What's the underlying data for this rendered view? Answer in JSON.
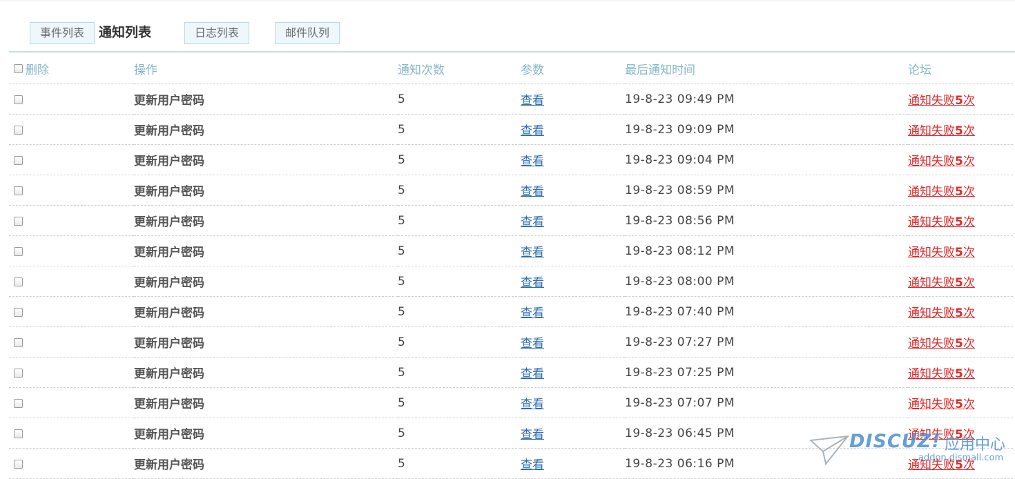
{
  "tabs": [
    {
      "label": "事件列表",
      "active": false
    },
    {
      "label": "通知列表",
      "active": true
    },
    {
      "label": "日志列表",
      "active": false
    },
    {
      "label": "邮件队列",
      "active": false
    }
  ],
  "table": {
    "headers": {
      "delete": "删除",
      "operation": "操作",
      "count": "通知次数",
      "params": "参数",
      "last_time": "最后通知时间",
      "forum": "论坛"
    },
    "rows": [
      {
        "operation": "更新用户密码",
        "count": "5",
        "params": "查看",
        "time": "19-8-23 09:49 PM",
        "status_prefix": "通知失败",
        "status_count": "5",
        "status_suffix": "次"
      },
      {
        "operation": "更新用户密码",
        "count": "5",
        "params": "查看",
        "time": "19-8-23 09:09 PM",
        "status_prefix": "通知失败",
        "status_count": "5",
        "status_suffix": "次"
      },
      {
        "operation": "更新用户密码",
        "count": "5",
        "params": "查看",
        "time": "19-8-23 09:04 PM",
        "status_prefix": "通知失败",
        "status_count": "5",
        "status_suffix": "次"
      },
      {
        "operation": "更新用户密码",
        "count": "5",
        "params": "查看",
        "time": "19-8-23 08:59 PM",
        "status_prefix": "通知失败",
        "status_count": "5",
        "status_suffix": "次"
      },
      {
        "operation": "更新用户密码",
        "count": "5",
        "params": "查看",
        "time": "19-8-23 08:56 PM",
        "status_prefix": "通知失败",
        "status_count": "5",
        "status_suffix": "次"
      },
      {
        "operation": "更新用户密码",
        "count": "5",
        "params": "查看",
        "time": "19-8-23 08:12 PM",
        "status_prefix": "通知失败",
        "status_count": "5",
        "status_suffix": "次"
      },
      {
        "operation": "更新用户密码",
        "count": "5",
        "params": "查看",
        "time": "19-8-23 08:00 PM",
        "status_prefix": "通知失败",
        "status_count": "5",
        "status_suffix": "次"
      },
      {
        "operation": "更新用户密码",
        "count": "5",
        "params": "查看",
        "time": "19-8-23 07:40 PM",
        "status_prefix": "通知失败",
        "status_count": "5",
        "status_suffix": "次"
      },
      {
        "operation": "更新用户密码",
        "count": "5",
        "params": "查看",
        "time": "19-8-23 07:27 PM",
        "status_prefix": "通知失败",
        "status_count": "5",
        "status_suffix": "次"
      },
      {
        "operation": "更新用户密码",
        "count": "5",
        "params": "查看",
        "time": "19-8-23 07:25 PM",
        "status_prefix": "通知失败",
        "status_count": "5",
        "status_suffix": "次"
      },
      {
        "operation": "更新用户密码",
        "count": "5",
        "params": "查看",
        "time": "19-8-23 07:07 PM",
        "status_prefix": "通知失败",
        "status_count": "5",
        "status_suffix": "次"
      },
      {
        "operation": "更新用户密码",
        "count": "5",
        "params": "查看",
        "time": "19-8-23 06:45 PM",
        "status_prefix": "通知失败",
        "status_count": "5",
        "status_suffix": "次"
      },
      {
        "operation": "更新用户密码",
        "count": "5",
        "params": "查看",
        "time": "19-8-23 06:16 PM",
        "status_prefix": "通知失败",
        "status_count": "5",
        "status_suffix": "次"
      }
    ]
  },
  "watermark": {
    "logo": "DISCUZ!",
    "subtitle": "应用中心",
    "url": "addon.dismall.com"
  },
  "colors": {
    "header_text": "#86b6ca",
    "link": "#2c6db4",
    "failure": "#e02a2a"
  }
}
